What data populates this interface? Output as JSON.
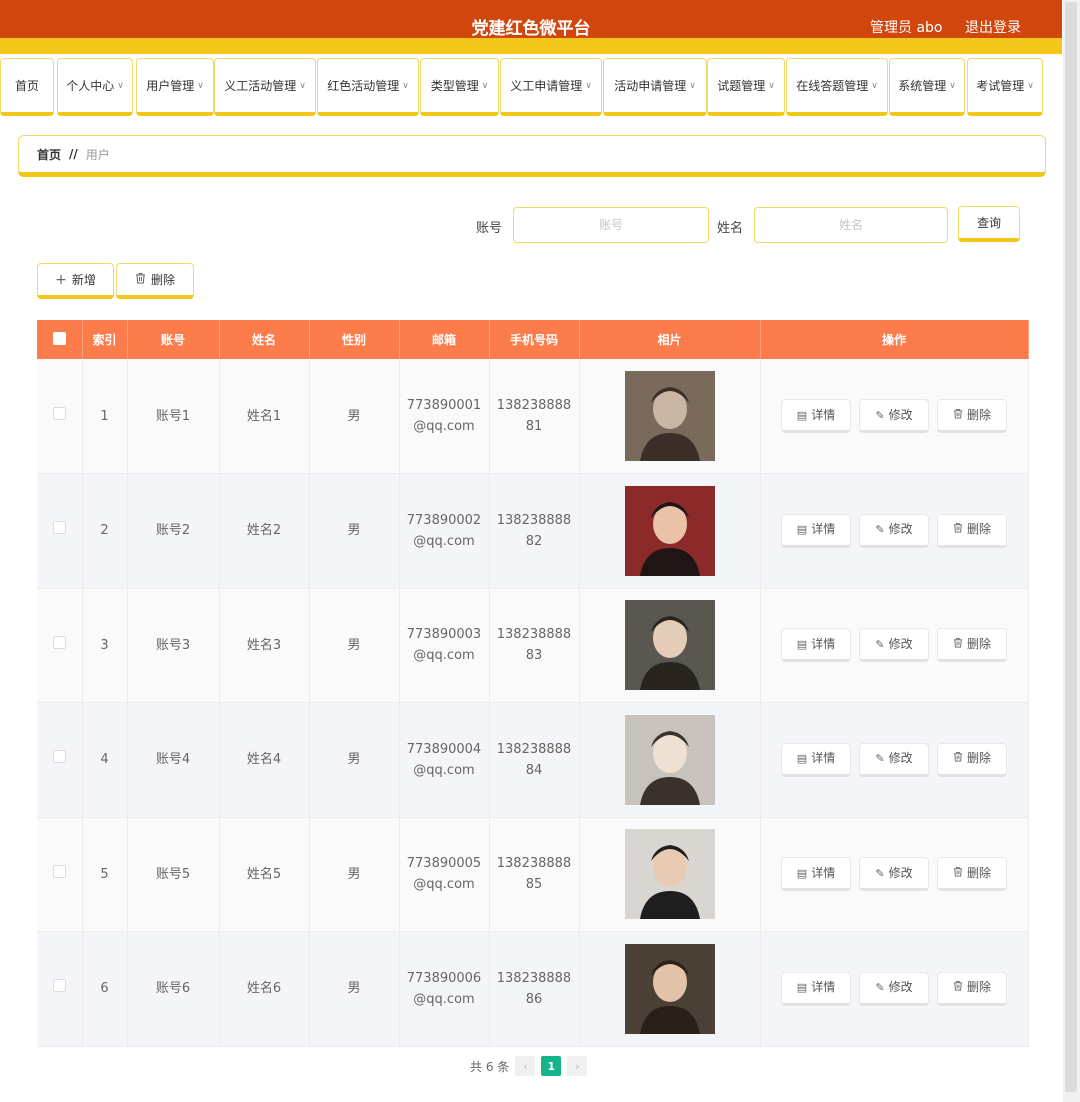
{
  "header": {
    "title": "党建红色微平台",
    "admin": "管理员 abo",
    "logout": "退出登录"
  },
  "nav": [
    {
      "label": "首页",
      "dropdown": false
    },
    {
      "label": "个人中心",
      "dropdown": true
    },
    {
      "label": "用户管理",
      "dropdown": true
    },
    {
      "label": "义工活动管理",
      "dropdown": true
    },
    {
      "label": "红色活动管理",
      "dropdown": true
    },
    {
      "label": "类型管理",
      "dropdown": true
    },
    {
      "label": "义工申请管理",
      "dropdown": true
    },
    {
      "label": "活动申请管理",
      "dropdown": true
    },
    {
      "label": "试题管理",
      "dropdown": true
    },
    {
      "label": "在线答题管理",
      "dropdown": true
    },
    {
      "label": "系统管理",
      "dropdown": true
    },
    {
      "label": "考试管理",
      "dropdown": true
    }
  ],
  "breadcrumb": {
    "home": "首页",
    "sep": "//",
    "current": "用户"
  },
  "search": {
    "account_label": "账号",
    "account_placeholder": "账号",
    "name_label": "姓名",
    "name_placeholder": "姓名",
    "query_button": "查询"
  },
  "actions": {
    "add": "新增",
    "delete": "删除"
  },
  "table": {
    "headers": [
      "索引",
      "账号",
      "姓名",
      "性别",
      "邮箱",
      "手机号码",
      "相片",
      "操作"
    ],
    "op_labels": {
      "detail": "详情",
      "edit": "修改",
      "delete": "删除"
    },
    "rows": [
      {
        "index": "1",
        "account": "账号1",
        "name": "姓名1",
        "gender": "男",
        "email1": "773890001",
        "email2": "@qq.com",
        "phone1": "138238888",
        "phone2": "81"
      },
      {
        "index": "2",
        "account": "账号2",
        "name": "姓名2",
        "gender": "男",
        "email1": "773890002",
        "email2": "@qq.com",
        "phone1": "138238888",
        "phone2": "82"
      },
      {
        "index": "3",
        "account": "账号3",
        "name": "姓名3",
        "gender": "男",
        "email1": "773890003",
        "email2": "@qq.com",
        "phone1": "138238888",
        "phone2": "83"
      },
      {
        "index": "4",
        "account": "账号4",
        "name": "姓名4",
        "gender": "男",
        "email1": "773890004",
        "email2": "@qq.com",
        "phone1": "138238888",
        "phone2": "84"
      },
      {
        "index": "5",
        "account": "账号5",
        "name": "姓名5",
        "gender": "男",
        "email1": "773890005",
        "email2": "@qq.com",
        "phone1": "138238888",
        "phone2": "85"
      },
      {
        "index": "6",
        "account": "账号6",
        "name": "姓名6",
        "gender": "男",
        "email1": "773890006",
        "email2": "@qq.com",
        "phone1": "138238888",
        "phone2": "86"
      }
    ]
  },
  "pagination": {
    "total": "共 6 条",
    "current_page": "1"
  },
  "colors": {
    "header_bg": "#d0460c",
    "accent_yellow": "#f2c61a",
    "table_header": "#fc7c4c",
    "page_active": "#17b38a"
  }
}
